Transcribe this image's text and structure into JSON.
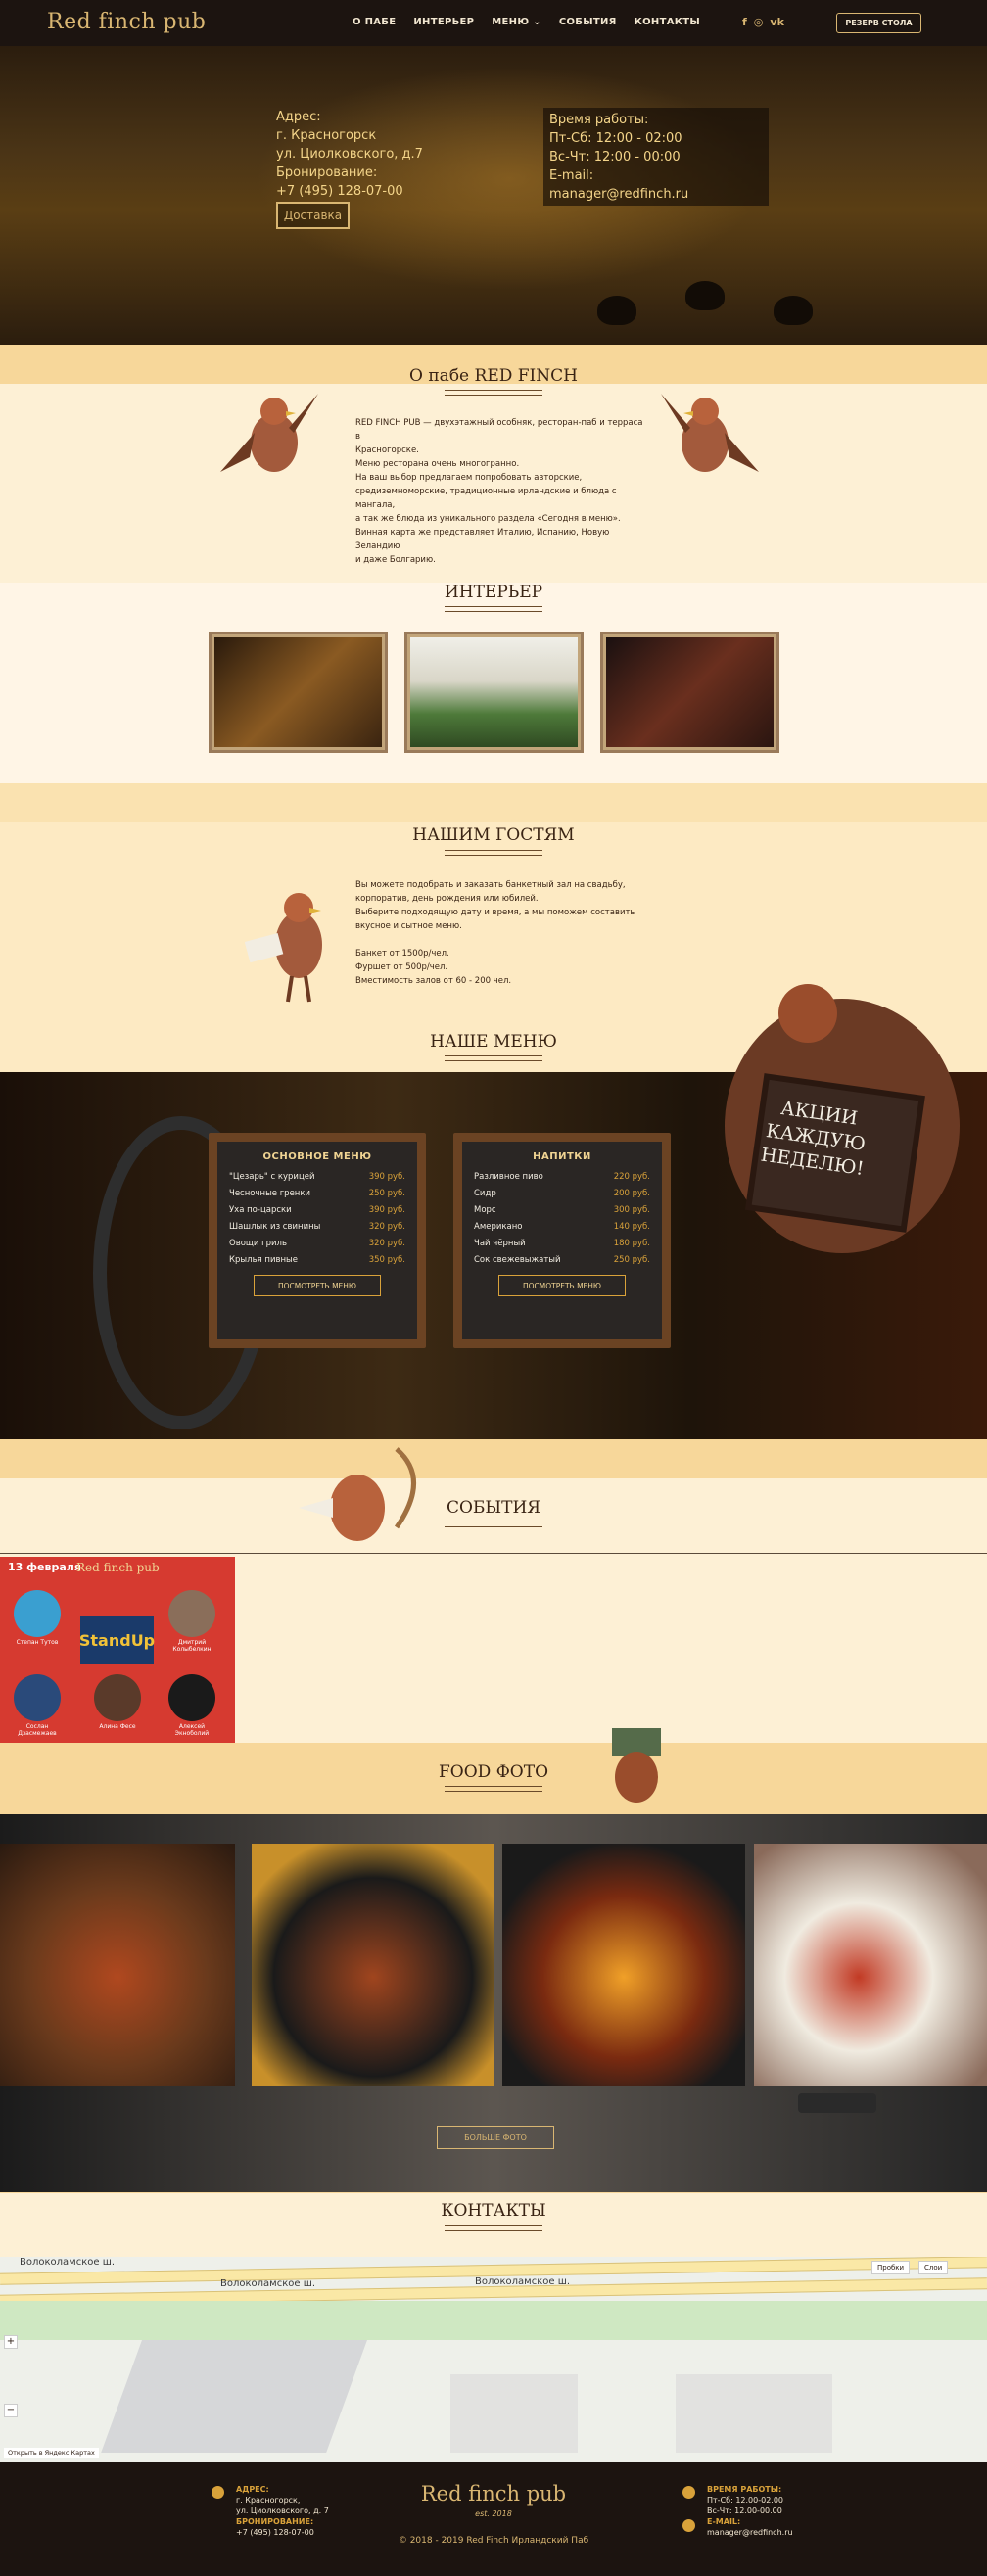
{
  "header": {
    "logo": "Red finch pub",
    "nav": [
      "О ПАБЕ",
      "ИНТЕРЬЕР",
      "МЕНЮ ⌄",
      "СОБЫТИЯ",
      "КОНТАКТЫ"
    ],
    "social": [
      "f",
      "◎",
      "vk"
    ],
    "reserve_label": "РЕЗЕРВ СТОЛА"
  },
  "hero": {
    "address_label": "Адрес:",
    "address_city": "г. Красногорск",
    "address_street": "ул. Циолковского, д.7",
    "booking_label": "Бронирование:",
    "phone": "+7 (495) 128-07-00",
    "delivery_label": "Доставка",
    "hours_label": "Время работы:",
    "hours_1": "Пт-Сб: 12:00 - 02:00",
    "hours_2": "Вс-Чт: 12:00 - 00:00",
    "email_label": "E-mail:",
    "email": "manager@redfinch.ru"
  },
  "about": {
    "title": "О пабе RED FINCH",
    "lines": [
      "RED FINCH PUB — двухэтажный особняк, ресторан-паб и терраса в",
      "Красногорске.",
      "Меню ресторана очень многогранно.",
      "На ваш выбор предлагаем попробовать авторские,",
      "средиземноморские, традиционные ирландские и блюда с мангала,",
      "а так же блюда из уникального раздела «Сегодня в меню».",
      "Винная карта же представляет Италию, Испанию, Новую Зеландию",
      "и даже Болгарию."
    ]
  },
  "interior": {
    "title": "ИНТЕРЬЕР"
  },
  "guests": {
    "title": "НАШИМ ГОСТЯМ",
    "lines": [
      "Вы можете подобрать и заказать банкетный зал на свадьбу,",
      "корпоратив, день рождения или юбилей.",
      "Выберите подходящую дату и время, а мы поможем составить",
      "вкусное и сытное меню.",
      "",
      "Банкет от 1500р/чел.",
      "Фуршет от 500р/чел.",
      "Вместимость залов от 60 - 200 чел."
    ]
  },
  "menu": {
    "title": "НАШЕ МЕНЮ",
    "promo": "АКЦИИ КАЖДУЮ НЕДЕЛЮ!",
    "main": {
      "title": "ОСНОВНОЕ МЕНЮ",
      "items": [
        {
          "name": "\"Цезарь\" с курицей",
          "price": "390 руб."
        },
        {
          "name": "Чесночные гренки",
          "price": "250 руб."
        },
        {
          "name": "Уха по-царски",
          "price": "390 руб."
        },
        {
          "name": "Шашлык из свинины",
          "price": "320 руб."
        },
        {
          "name": "Овощи гриль",
          "price": "320 руб."
        },
        {
          "name": "Крылья пивные",
          "price": "350 руб."
        }
      ],
      "button": "ПОСМОТРЕТЬ МЕНЮ"
    },
    "drinks": {
      "title": "НАПИТКИ",
      "items": [
        {
          "name": "Разливное пиво",
          "price": "220 руб."
        },
        {
          "name": "Сидр",
          "price": "200 руб."
        },
        {
          "name": "Морс",
          "price": "300 руб."
        },
        {
          "name": "Американо",
          "price": "140 руб."
        },
        {
          "name": "Чай чёрный",
          "price": "180 руб."
        },
        {
          "name": "Сок свежевыжатый",
          "price": "250 руб."
        }
      ],
      "button": "ПОСМОТРЕТЬ МЕНЮ"
    }
  },
  "events": {
    "title": "СОБЫТИЯ",
    "poster_date": "13 февраля",
    "poster_logo": "Red finch pub",
    "poster_title": "StandUp",
    "poster_names": [
      "Степан Тутов",
      "Дмитрий Колыбелкин",
      "Сослан Дзасмежаев",
      "Алина Фесе",
      "Алексей Экноболий"
    ]
  },
  "food": {
    "title": "FOOD ФОТО",
    "more_button": "БОЛЬШЕ ФОТО"
  },
  "contacts": {
    "title": "КОНТАКТЫ",
    "street_1": "Волоколамское ш.",
    "street_2": "Волоколамское ш.",
    "street_3": "Волоколамское ш.",
    "map_tools": [
      "Пробки",
      "Слои"
    ],
    "map_link": "Открыть в Яндекс.Картах"
  },
  "footer": {
    "address_label": "АДРЕС:",
    "address_city": "г. Красногорск,",
    "address_street": "ул. Циолковского, д. 7",
    "booking_label": "БРОНИРОВАНИЕ:",
    "phone": "+7 (495) 128-07-00",
    "logo": "Red finch pub",
    "est": "est. 2018",
    "copyright": "© 2018 - 2019 Red Finch Ирландский Паб",
    "hours_label": "ВРЕМЯ РАБОТЫ:",
    "hours_1": "Пт-Сб: 12.00-02.00",
    "hours_2": "Вс-Чт: 12.00-00.00",
    "email_label": "E-MAIL:",
    "email": "manager@redfinch.ru"
  },
  "colors": {
    "accent": "#d9b672",
    "dark": "#1c1410",
    "cream": "#fdf0d5",
    "price": "#d9a23a"
  }
}
